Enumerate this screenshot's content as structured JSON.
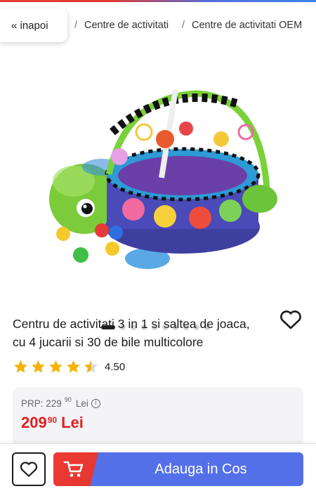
{
  "colors": {
    "accent_red": "#e02020",
    "button_blue": "#5470e8",
    "star_gold": "#f5b301"
  },
  "breadcrumb": {
    "back_label": "« inapoi",
    "hidden_fragment": "i",
    "separator": "/",
    "items": [
      "Centre de activitati",
      "Centre de activitati OEM"
    ]
  },
  "gallery": {
    "image_icon": "product-photo",
    "wishlist_icon": "heart-outline-icon",
    "dots_total": 10,
    "active_index": 0
  },
  "product": {
    "title_line1": "Centru de activitati 3 in 1 si saltea de joaca,",
    "title_line2": "cu 4 jucarii si 30 de bile multicolore",
    "rating_value": "4.50",
    "rating_stars": 4.5
  },
  "pricing": {
    "prp_label": "PRP: 229",
    "prp_decimals": "90",
    "prp_currency": "Lei",
    "price_int": "209",
    "price_dec": "90",
    "price_currency": "Lei"
  },
  "actions": {
    "add_to_cart_label": "Adauga in Cos",
    "cart_icon": "shopping-cart-icon",
    "favorite_icon": "heart-outline-icon"
  }
}
